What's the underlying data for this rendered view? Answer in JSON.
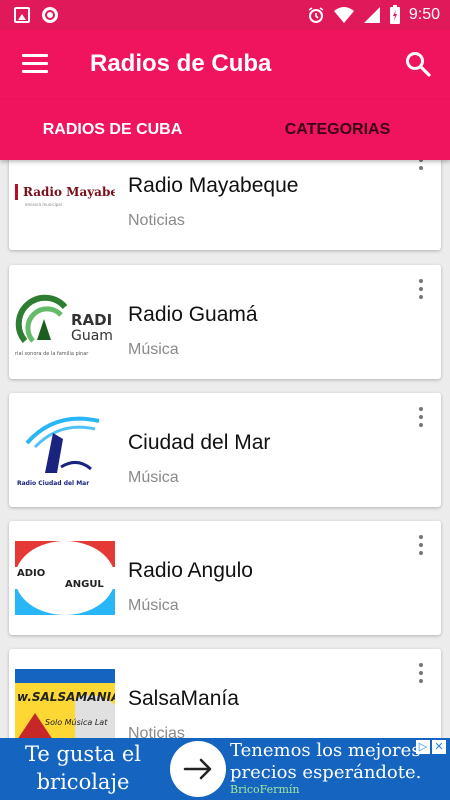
{
  "status_bar": {
    "time": "9:50"
  },
  "app_bar": {
    "title": "Radios de Cuba"
  },
  "tabs": [
    {
      "label": "RADIOS DE CUBA",
      "active": true
    },
    {
      "label": "CATEGORIAS",
      "active": false
    }
  ],
  "stations": [
    {
      "name": "Radio Mayabeque",
      "category": "Noticias",
      "logo_text": "Radio Mayabeq"
    },
    {
      "name": "Radio Guamá",
      "category": "Música",
      "logo_text": "RADI Guam"
    },
    {
      "name": "Ciudad del Mar",
      "category": "Música",
      "logo_text": "Radio Ciudad del Mar"
    },
    {
      "name": "Radio Angulo",
      "category": "Música",
      "logo_text": "ADIO ANGUL"
    },
    {
      "name": "SalsaManía",
      "category": "Noticias",
      "logo_text": "SALSAMANIA"
    }
  ],
  "ad": {
    "left_text": "Te gusta el bricolaje",
    "right_text": "Tenemos los mejores precios esperándote.",
    "brand": "BricoFermín",
    "colors": {
      "background": "#1565c0",
      "brand": "#9fe6a0"
    }
  },
  "colors": {
    "primary": "#f0145f",
    "status_bar": "#e0195a",
    "background": "#ececec"
  }
}
